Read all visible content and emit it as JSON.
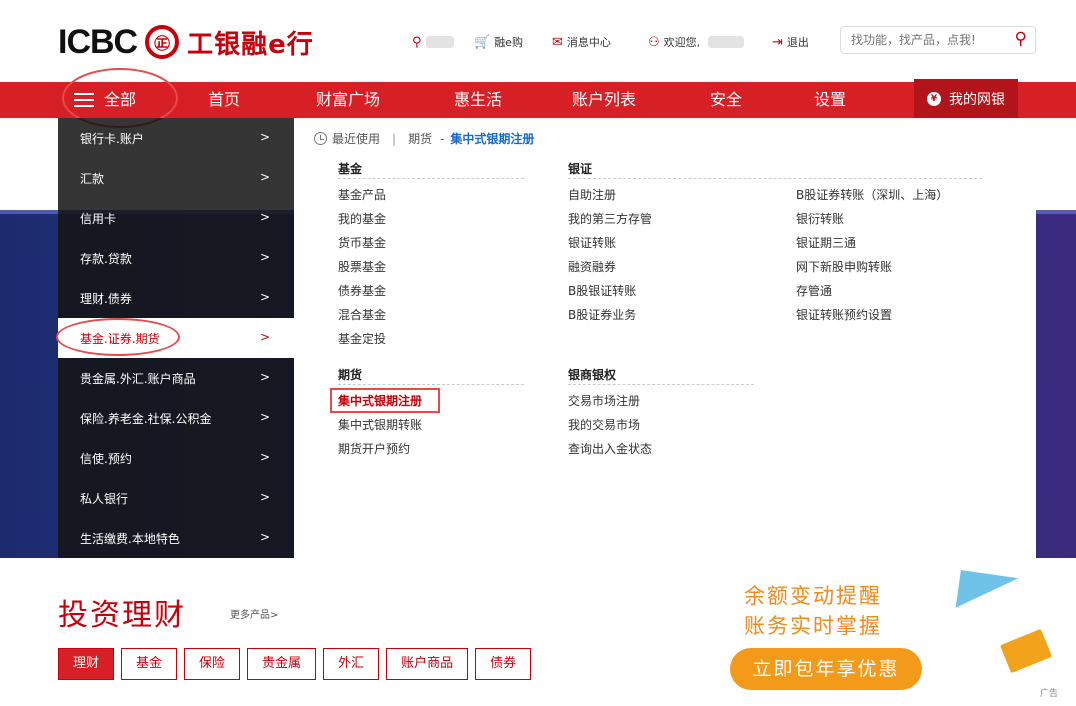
{
  "header": {
    "logo_text": "ICBC",
    "seal_text": "㊣",
    "bank_name": "工银融e行",
    "rong_e_gou": "融e购",
    "message_center": "消息中心",
    "welcome": "欢迎您,",
    "logout": "退出",
    "search_placeholder": "找功能，找产品，点我!"
  },
  "nav": {
    "all": "全部",
    "items": [
      "首页",
      "财富广场",
      "惠生活",
      "账户列表",
      "安全",
      "设置"
    ],
    "my_online_bank": "我的网银"
  },
  "left_menu": [
    {
      "label": "银行卡.账户"
    },
    {
      "label": "汇款"
    },
    {
      "label": "信用卡"
    },
    {
      "label": "存款.贷款"
    },
    {
      "label": "理财.债券"
    },
    {
      "label": "基金.证券.期货",
      "active": true
    },
    {
      "label": "贵金属.外汇.账户商品"
    },
    {
      "label": "保险.养老金.社保.公积金"
    },
    {
      "label": "信使.预约"
    },
    {
      "label": "私人银行"
    },
    {
      "label": "生活缴费.本地特色"
    }
  ],
  "arrow": ">",
  "recent": {
    "label": "最近使用",
    "category": "期货",
    "dash": "-",
    "item": "集中式银期注册"
  },
  "sections": {
    "fund": {
      "title": "基金",
      "links": [
        "基金产品",
        "我的基金",
        "货币基金",
        "股票基金",
        "债券基金",
        "混合基金",
        "基金定投"
      ]
    },
    "bank_securities": {
      "title": "银证",
      "links": [
        "自助注册",
        "我的第三方存管",
        "银证转账",
        "融资融券",
        "B股银证转账",
        "B股证券业务"
      ]
    },
    "bank_securities_more": {
      "links": [
        "B股证券转账（深圳、上海）",
        "银衍转账",
        "银证期三通",
        "网下新股申购转账",
        "存管通",
        "银证转账预约设置"
      ]
    },
    "futures": {
      "title": "期货",
      "links": [
        "集中式银期注册",
        "集中式银期转账",
        "期货开户预约"
      ]
    },
    "bank_commodity": {
      "title": "银商银权",
      "links": [
        "交易市场注册",
        "我的交易市场",
        "查询出入金状态"
      ]
    }
  },
  "invest": {
    "title": "投资理财",
    "more": "更多产品>",
    "tabs": [
      "理财",
      "基金",
      "保险",
      "贵金属",
      "外汇",
      "账户商品",
      "债券"
    ]
  },
  "ad": {
    "line1": "余额变动提醒",
    "line2": "账务实时掌握",
    "button": "立即包年享优惠",
    "tag": "广告"
  },
  "colors": {
    "brand_red": "#d71f26",
    "link_blue": "#1a6ac9",
    "ad_orange": "#f39a1b"
  }
}
